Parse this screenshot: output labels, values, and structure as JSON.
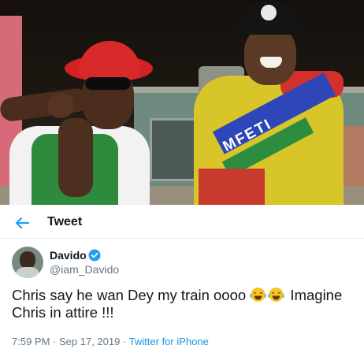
{
  "header": {
    "back_icon": "arrow-left-icon",
    "title": "Tweet"
  },
  "author": {
    "name": "Davido",
    "handle": "@iam_Davido",
    "verified": true,
    "verified_color": "#1da1f2"
  },
  "tweet": {
    "text_part1": "Chris say he wan Dey my train oooo ",
    "emoji": "face-with-tears-of-joy-icon",
    "emoji_count": 2,
    "text_part2": " Imagine Chris in attire !!!"
  },
  "meta": {
    "time": "7:59 PM",
    "separator1": " · ",
    "date": "Sep 17, 2019",
    "separator2": " · ",
    "source": "Twitter for iPhone"
  },
  "photo": {
    "jersey_text": "MFETI"
  },
  "colors": {
    "accent": "#1da1f2",
    "text": "#14171a",
    "secondary_text": "#657786"
  }
}
